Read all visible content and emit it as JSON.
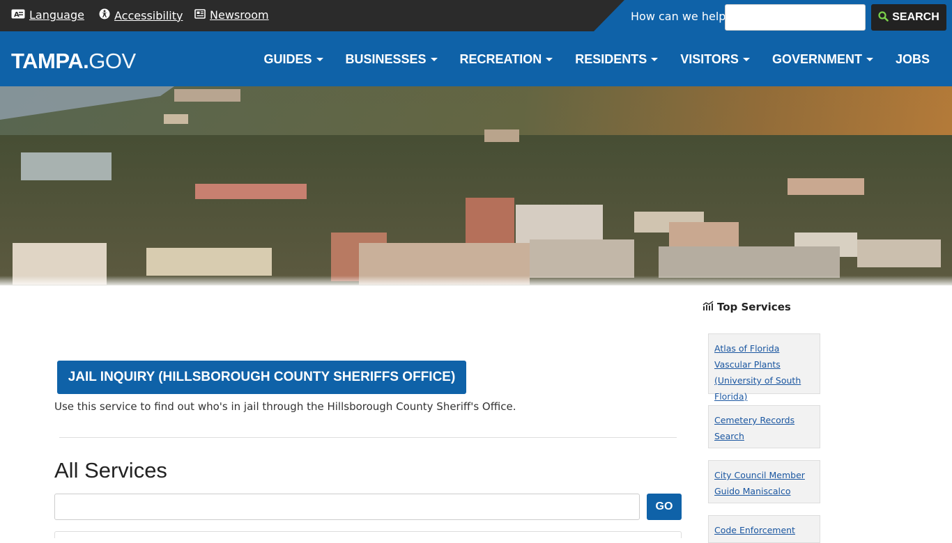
{
  "utility_bar": {
    "language": "Language",
    "accessibility": "Accessibility",
    "newsroom": "Newsroom",
    "help_label": "How can we help?",
    "search_button": "SEARCH",
    "search_value": ""
  },
  "header": {
    "logo_bold": "TAMPA.",
    "logo_light": "GOV",
    "nav": [
      {
        "label": "GUIDES"
      },
      {
        "label": "BUSINESSES"
      },
      {
        "label": "RECREATION"
      },
      {
        "label": "RESIDENTS"
      },
      {
        "label": "VISITORS"
      },
      {
        "label": "GOVERNMENT"
      },
      {
        "label": "JOBS"
      }
    ]
  },
  "main": {
    "jail_button": "JAIL INQUIRY (HILLSBOROUGH COUNTY SHERIFFS OFFICE)",
    "jail_description": "Use this service to find out who's in jail through the Hillsborough County Sheriff's Office.",
    "all_services_heading": "All Services",
    "services_search_value": "",
    "go_button": "GO"
  },
  "sidebar": {
    "heading": "Top Services",
    "items": [
      {
        "label": "Atlas of Florida Vascular Plants (University of South Florida)"
      },
      {
        "label": "Cemetery Records Search"
      },
      {
        "label": "City Council Member Guido Maniscalco"
      },
      {
        "label": "Code Enforcement"
      }
    ]
  },
  "colors": {
    "brand_blue": "#0f62a8",
    "utility_dark": "#2b2b2b",
    "search_icon_green": "#7bd14b",
    "link_blue": "#1a56a0"
  }
}
